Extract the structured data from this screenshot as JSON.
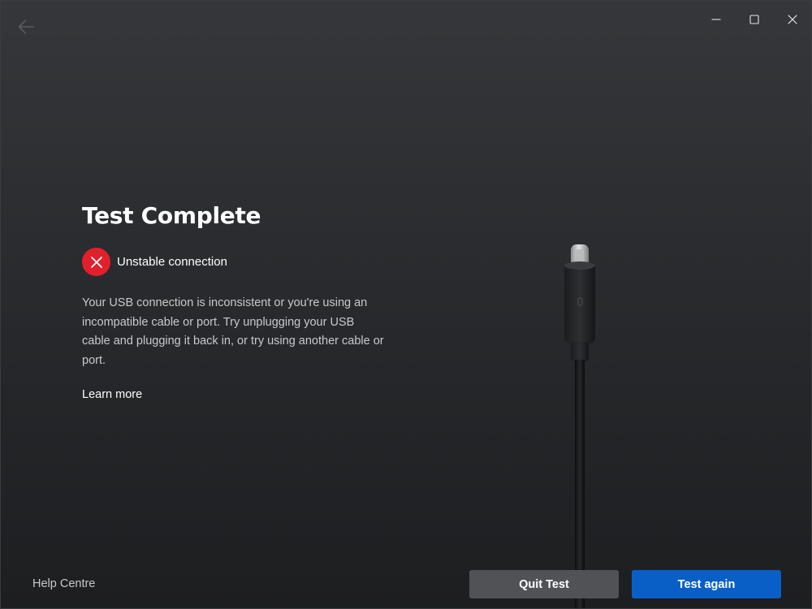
{
  "window": {
    "back_icon": "arrow-left-icon",
    "minimize_icon": "minimize-icon",
    "maximize_icon": "maximize-icon",
    "close_icon": "close-icon"
  },
  "main": {
    "title": "Test Complete",
    "status": {
      "icon": "error-x-icon",
      "color": "#e2202c",
      "text": "Unstable connection"
    },
    "description": "Your USB connection is inconsistent or you're using an incompatible cable or port. Try unplugging your USB cable and plugging it back in, or try using another cable or port.",
    "learn_more": "Learn more"
  },
  "footer": {
    "help": "Help Centre",
    "quit_label": "Quit Test",
    "again_label": "Test again",
    "again_color": "#0a5fc7"
  }
}
